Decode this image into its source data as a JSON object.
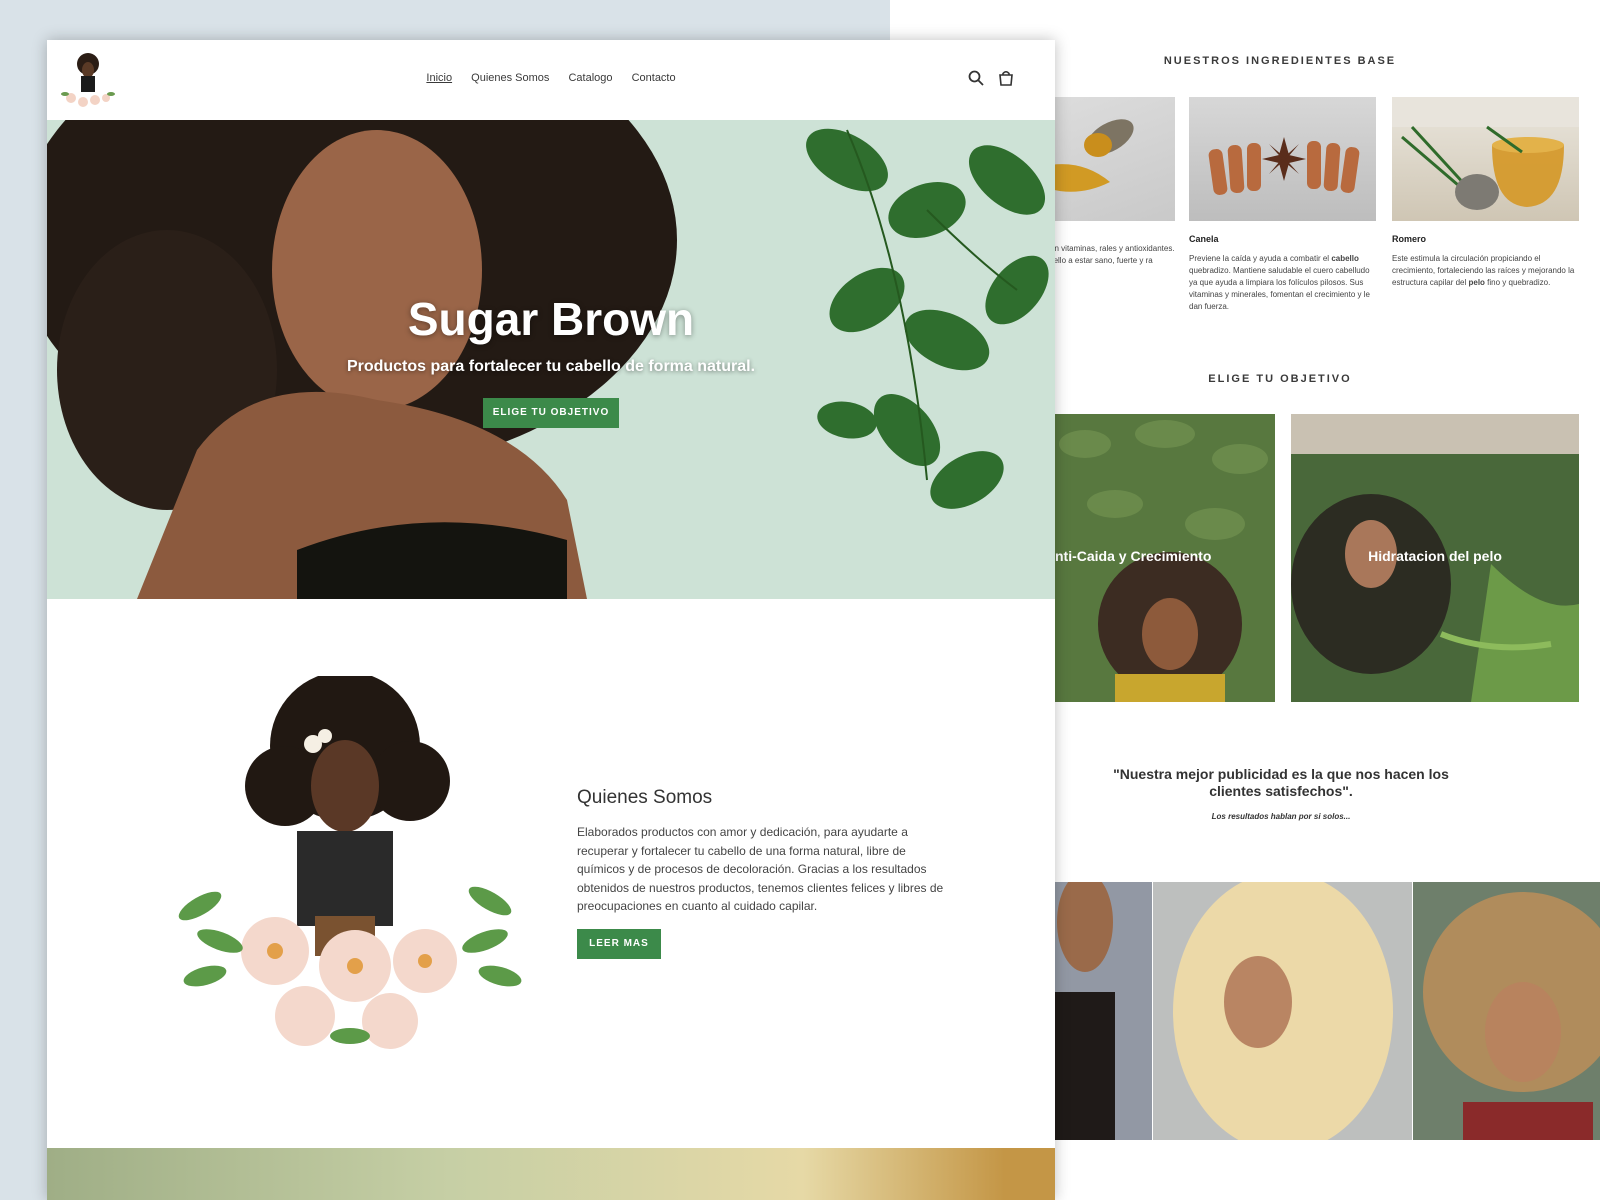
{
  "front": {
    "nav": {
      "items": [
        "Inicio",
        "Quienes Somos",
        "Catalogo",
        "Contacto"
      ],
      "active": "Inicio"
    },
    "header_icons": [
      "search-icon",
      "cart-icon"
    ],
    "hero": {
      "title": "Sugar Brown",
      "subtitle": "Productos para fortalecer tu cabello de forma natural.",
      "button": "ELIGE TU OBJETIVO"
    },
    "about": {
      "title": "Quienes Somos",
      "text": "Elaborados productos con amor y dedicación, para ayudarte a recuperar y fortalecer tu cabello de una forma natural, libre de químicos y de procesos de decoloración. Gracias a los resultados obtenidos de nuestros productos, tenemos clientes felices y libres de preocupaciones en cuanto al cuidado capilar.",
      "button": "LEER MAS"
    }
  },
  "back": {
    "ingredients_heading": "NUESTROS INGREDIENTES BASE",
    "ingredients": [
      {
        "name": "",
        "desc": "abundante en vitaminas, rales y antioxidantes. Estos al cabello a estar sano, fuerte y ra natural."
      },
      {
        "name": "Canela",
        "desc_before": "Previene la caída y ayuda a combatir el ",
        "desc_bold": "cabello",
        "desc_after": " quebradizo. Mantiene saludable el cuero cabelludo ya que ayuda a limpiara los folículos pilosos. Sus vitaminas y minerales, fomentan el crecimiento y le dan fuerza."
      },
      {
        "name": "Romero",
        "desc_before": "Este estimula la circulación propiciando el crecimiento, fortaleciendo las raíces y mejorando la estructura capilar del ",
        "desc_bold": "pelo",
        "desc_after": " fino y quebradizo."
      }
    ],
    "goals_heading": "ELIGE TU OBJETIVO",
    "goals": [
      "nti-Caida y Crecimiento",
      "Hidratacion del pelo"
    ],
    "quote": "\"Nuestra mejor publicidad es la que nos hacen los clientes satisfechos\".",
    "quote_sub": "Los resultados hablan por si solos..."
  },
  "colors": {
    "accent_green": "#3c8a4a",
    "hero_bg": "#cce1d5",
    "page_bg": "#d9e2e8"
  }
}
